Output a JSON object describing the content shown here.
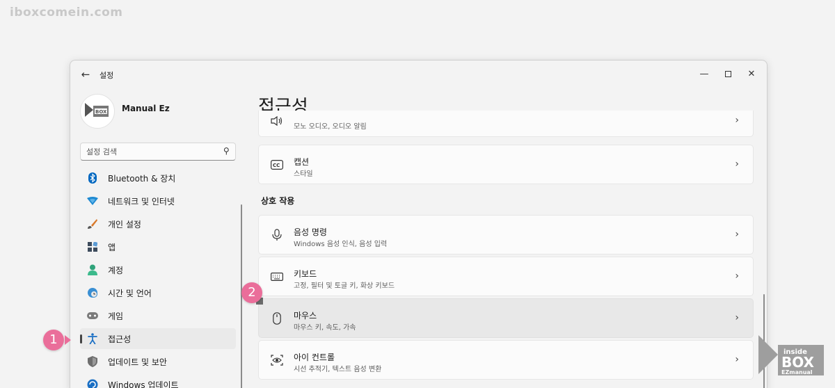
{
  "watermark": "iboxcomein.com",
  "window": {
    "title": "설정",
    "back_icon": "back-arrow-icon",
    "controls": {
      "minimize": "—",
      "close": "✕"
    }
  },
  "profile": {
    "name": "Manual Ez"
  },
  "search": {
    "placeholder": "설정 검색",
    "icon": "search-icon"
  },
  "nav": {
    "items": [
      {
        "label": "Bluetooth & 장치",
        "icon": "bluetooth-icon"
      },
      {
        "label": "네트워크 및 인터넷",
        "icon": "wifi-icon"
      },
      {
        "label": "개인 설정",
        "icon": "brush-icon"
      },
      {
        "label": "앱",
        "icon": "apps-icon"
      },
      {
        "label": "계정",
        "icon": "account-icon"
      },
      {
        "label": "시간 및 언어",
        "icon": "globe-icon"
      },
      {
        "label": "게임",
        "icon": "gamepad-icon"
      },
      {
        "label": "접근성",
        "icon": "accessibility-icon",
        "active": true
      },
      {
        "label": "업데이트 및 보안",
        "icon": "shield-icon"
      },
      {
        "label": "Windows 업데이트",
        "icon": "update-icon"
      }
    ]
  },
  "main": {
    "title": "접근성",
    "section_interaction": "상호 작용",
    "cards": [
      {
        "title": "",
        "subtitle": "모노 오디오, 오디오 알림",
        "icon": "speaker-icon"
      },
      {
        "title": "캡션",
        "subtitle": "스타일",
        "icon": "cc-icon"
      },
      {
        "title": "음성 명령",
        "subtitle": "Windows 음성 인식, 음성 입력",
        "icon": "microphone-icon"
      },
      {
        "title": "키보드",
        "subtitle": "고정, 필터 및 토글 키, 화상 키보드",
        "icon": "keyboard-icon"
      },
      {
        "title": "마우스",
        "subtitle": "마우스 키, 속도, 가속",
        "icon": "mouse-icon",
        "highlighted": true
      },
      {
        "title": "아이 컨트롤",
        "subtitle": "시선 추적기, 텍스트 음성 변환",
        "icon": "eye-control-icon"
      }
    ]
  },
  "annotations": {
    "step1": "1",
    "step2": "2"
  },
  "colors": {
    "badge": "#ea6e9a",
    "accent_blue": "#0067c0"
  }
}
